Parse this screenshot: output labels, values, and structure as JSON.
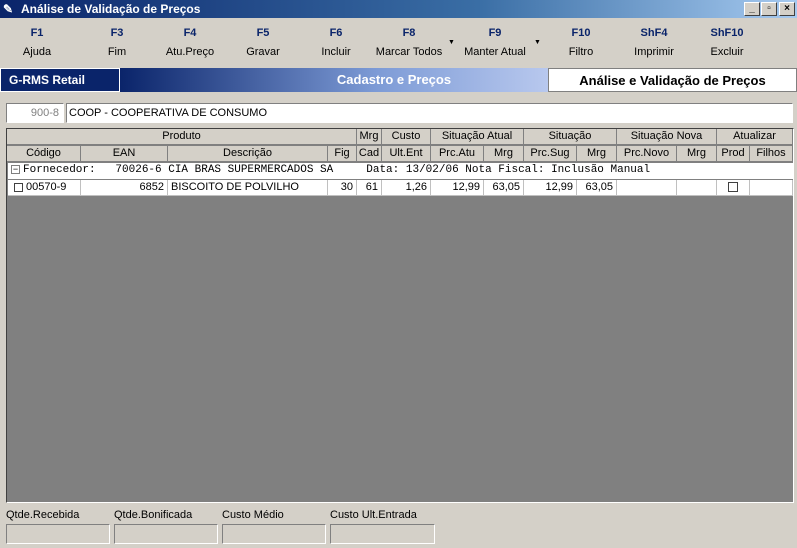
{
  "window": {
    "title": "Análise de Validação de Preços",
    "buttons": [
      "_",
      "▫",
      "×"
    ]
  },
  "toolbar": [
    {
      "key": "F1",
      "label": "Ajuda"
    },
    {
      "key": "F3",
      "label": "Fim"
    },
    {
      "key": "F4",
      "label": "Atu.Preço"
    },
    {
      "key": "F5",
      "label": "Gravar"
    },
    {
      "key": "F6",
      "label": "Incluir"
    },
    {
      "key": "F8",
      "label": "Marcar Todos"
    },
    {
      "key": "F9",
      "label": "Manter Atual"
    },
    {
      "key": "F10",
      "label": "Filtro"
    },
    {
      "key": "ShF4",
      "label": "Imprimir"
    },
    {
      "key": "ShF10",
      "label": "Excluir"
    }
  ],
  "banner": {
    "app": "G-RMS Retail",
    "section": "Cadastro e Preços",
    "screen": "Análise e Validação de Preços"
  },
  "store": {
    "code": "900-8",
    "name": "COOP - COOPERATIVA DE CONSUMO"
  },
  "grid": {
    "groups": [
      "Produto",
      "Mrg",
      "Custo",
      "Situação Atual",
      "Situação",
      "Situação Nova",
      "Atualizar"
    ],
    "columns": [
      "Código",
      "EAN",
      "Descrição",
      "Fig",
      "Cad",
      "Ult.Ent",
      "Prc.Atu",
      "Mrg",
      "Prc.Sug",
      "Mrg",
      "Prc.Novo",
      "Mrg",
      "Prod",
      "Filhos"
    ],
    "supplier_line": "Fornecedor:   70026-6 CIA BRAS SUPERMERCADOS SA     Data: 13/02/06 Nota Fiscal: Inclusão Manual",
    "rows": [
      {
        "codigo": "00570-9",
        "ean": "6852",
        "descricao": "BISCOITO DE POLVILHO",
        "fig": "30",
        "cad": "61",
        "ult_ent": "1,26",
        "prc_atu": "12,99",
        "mrg_atu": "63,05",
        "prc_sug": "12,99",
        "mrg_sug": "63,05",
        "prc_novo": "",
        "mrg_novo": "",
        "prod": false,
        "filhos": ""
      }
    ]
  },
  "footer": {
    "labels": [
      "Qtde.Recebida",
      "Qtde.Bonificada",
      "Custo Médio",
      "Custo Ult.Entrada"
    ]
  }
}
